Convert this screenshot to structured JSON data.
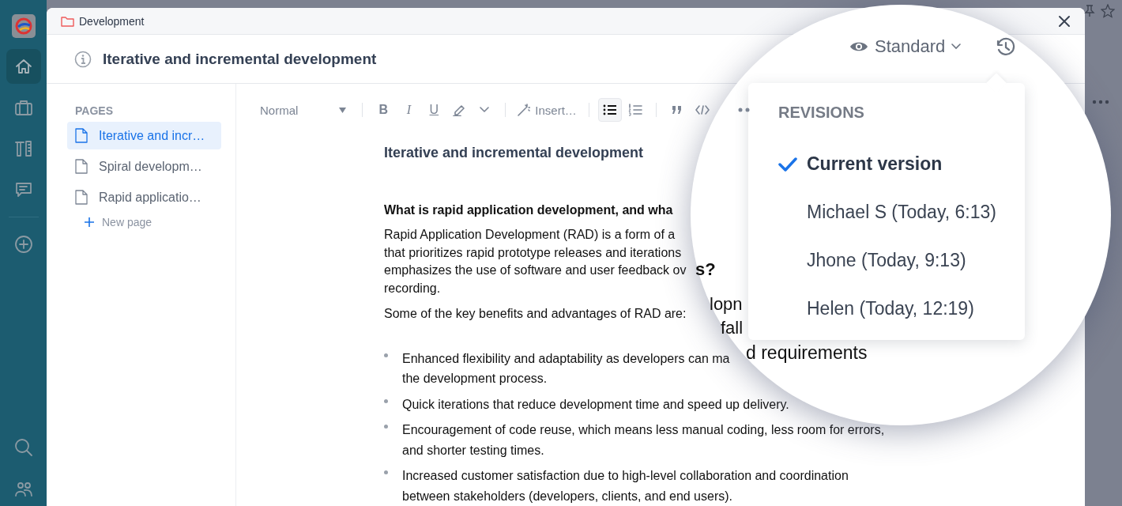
{
  "rail": {
    "items": [
      {
        "kind": "home",
        "selected": true
      },
      {
        "kind": "briefcase",
        "selected": false
      },
      {
        "kind": "tools",
        "selected": false
      },
      {
        "kind": "chat",
        "selected": false
      },
      {
        "kind": "add",
        "selected": false
      },
      {
        "kind": "search",
        "selected": false
      },
      {
        "kind": "people",
        "selected": false
      }
    ]
  },
  "dialog": {
    "breadcrumb": "Development",
    "title": "Iterative and incremental development"
  },
  "view_mode": {
    "label": "Standard"
  },
  "pages": {
    "heading": "PAGES",
    "items": [
      {
        "label": "Iterative and incr…",
        "selected": true
      },
      {
        "label": "Spiral developm…",
        "selected": false
      },
      {
        "label": "Rapid applicatio…",
        "selected": false
      }
    ],
    "new_page": "New page"
  },
  "toolbar": {
    "style": "Normal",
    "items": [
      {
        "kind": "bold",
        "label": "B",
        "active": false
      },
      {
        "kind": "italic",
        "label": "I",
        "active": false
      },
      {
        "kind": "underline",
        "label": "U",
        "active": false
      },
      {
        "kind": "highlight",
        "active": false
      },
      {
        "kind": "more",
        "active": false
      },
      {
        "kind": "insert",
        "label": "Insert…",
        "active": false
      },
      {
        "kind": "bullets",
        "active": true
      },
      {
        "kind": "numbers",
        "active": false
      },
      {
        "kind": "quote",
        "active": false
      },
      {
        "kind": "code",
        "active": false
      },
      {
        "kind": "overflow",
        "active": false
      }
    ]
  },
  "document": {
    "title": "Iterative and incremental development",
    "heading": "What is rapid application development, and wha",
    "paragraphs": [
      "Rapid Application Development (RAD) is a form of a\nthat prioritizes rapid prototype releases and iterations\nemphasizes the use of software and user feedback ov\nrecording.",
      "Some of the key benefits and advantages of RAD are:"
    ],
    "bullets": [
      "Enhanced flexibility and adaptability as developers can ma\nthe development process.",
      "Quick iterations that reduce development time and speed up delivery.",
      "Encouragement of code reuse, which means less manual coding, less room for errors,\nand shorter testing times.",
      "Increased customer satisfaction due to high-level collaboration and coordination\nbetween stakeholders (developers, clients, and end users)."
    ]
  },
  "revisions": {
    "heading": "REVISIONS",
    "items": [
      {
        "label": "Current version",
        "selected": true
      },
      {
        "label": "Michael S (Today, 6:13)",
        "selected": false
      },
      {
        "label": "Jhone (Today, 9:13)",
        "selected": false
      },
      {
        "label": "Helen (Today, 12:19)",
        "selected": false
      }
    ]
  },
  "magnified_fragments": [
    "s?",
    "lopn",
    "fall",
    "d requirements"
  ]
}
